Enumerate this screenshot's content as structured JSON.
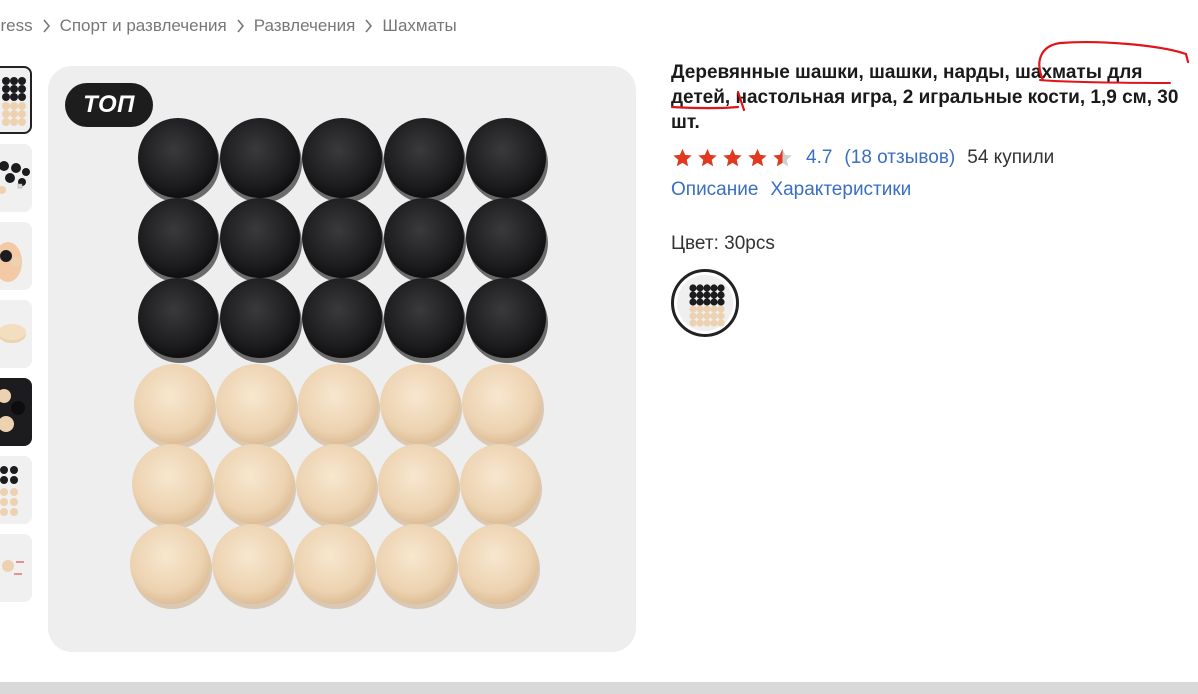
{
  "breadcrumb": {
    "items": [
      "press",
      "Спорт и развлечения",
      "Развлечения",
      "Шахматы"
    ]
  },
  "photo": {
    "badge": "ТОП",
    "dark_color": "#1c1c1e",
    "light_color": "#ecd2b0"
  },
  "product": {
    "title": "Деревянные шашки, шашки, нарды, шахматы для детей, настольная игра, 2 игральные кости, 1,9 см, 30 шт.",
    "rating": "4.7",
    "reviews": "(18 отзывов)",
    "bought": "54 купили",
    "tabs": [
      "Описание",
      "Характеристики"
    ],
    "color_label": "Цвет: 30pcs",
    "stars_filled": 4.5
  },
  "colors": {
    "star": "#e0391f",
    "link": "#3a6fc4",
    "annotation": "#e0141b"
  },
  "icons": {
    "breadcrumb_separator": "chevron-right-icon",
    "star": "star-icon"
  }
}
